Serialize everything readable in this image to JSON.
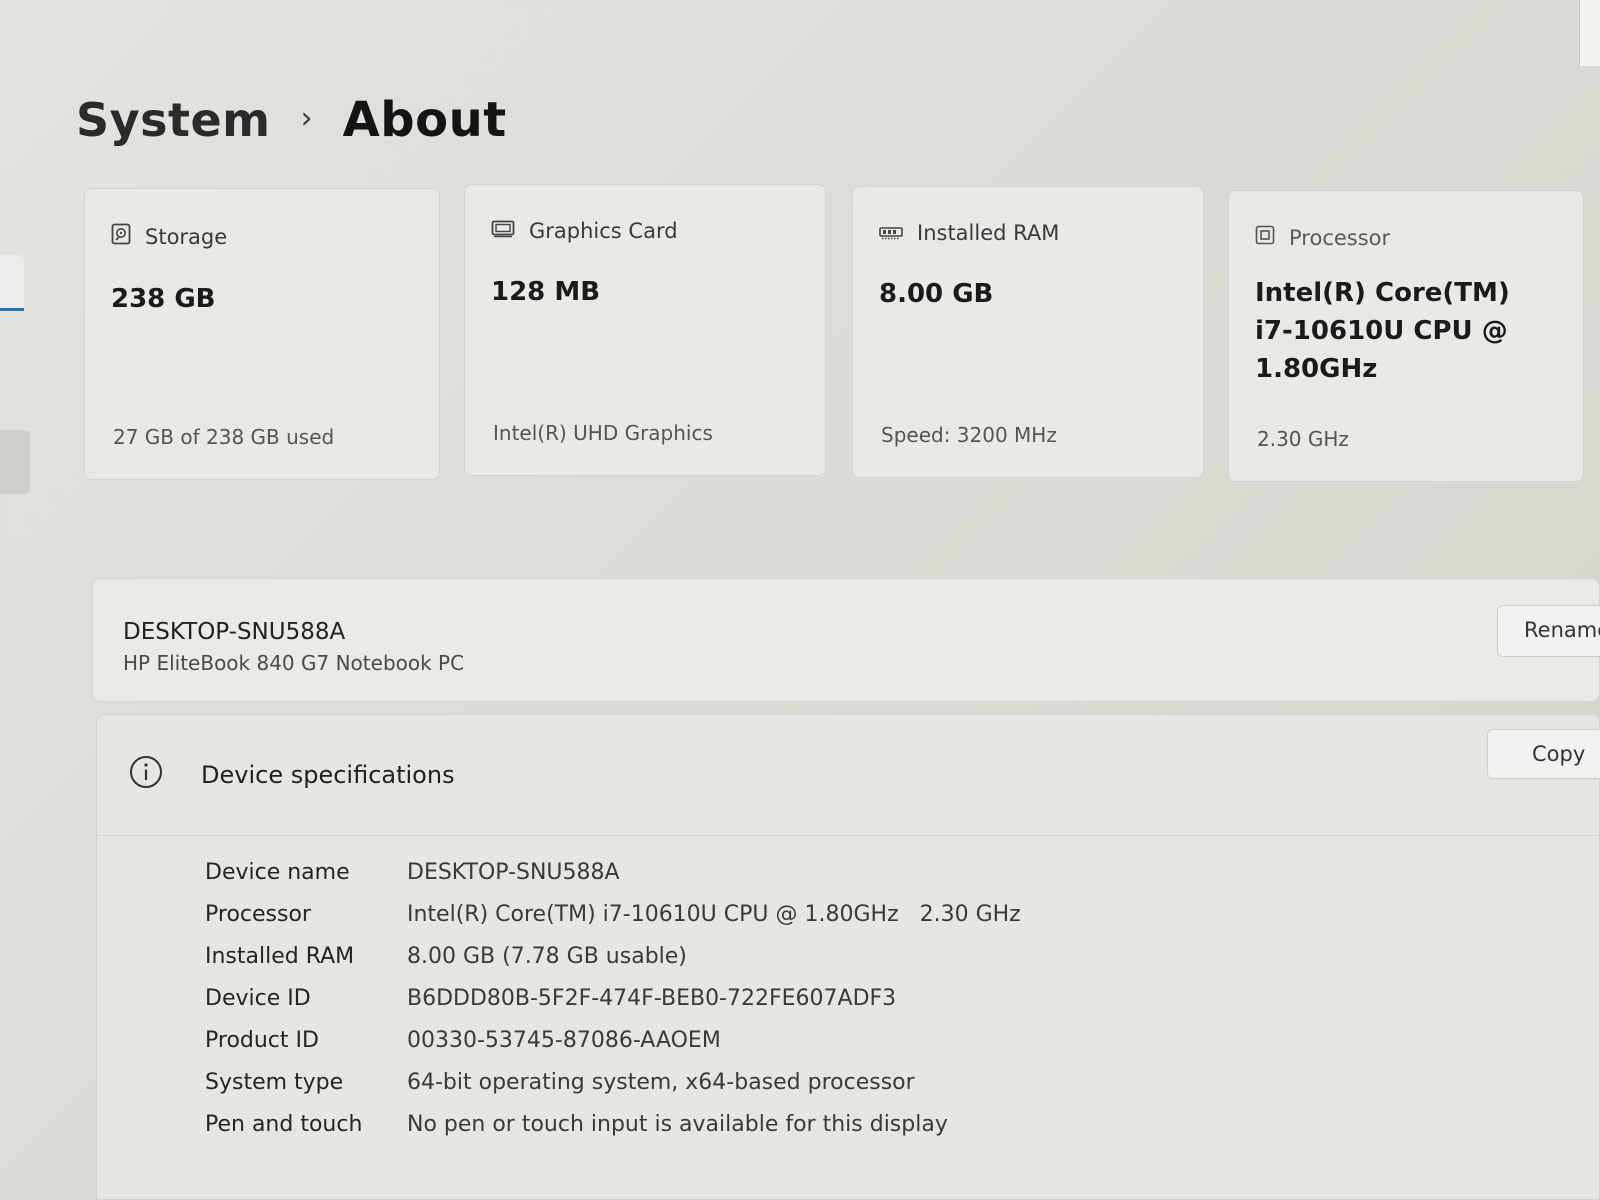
{
  "breadcrumb": {
    "parent": "System",
    "separator": "›",
    "current": "About"
  },
  "cards": {
    "storage": {
      "icon": "storage-icon",
      "title": "Storage",
      "value": "238 GB",
      "sub": "27 GB of 238 GB used"
    },
    "graphics": {
      "icon": "graphics-card-icon",
      "title": "Graphics Card",
      "value": "128 MB",
      "sub": "Intel(R) UHD Graphics"
    },
    "ram": {
      "icon": "ram-icon",
      "title": "Installed RAM",
      "value": "8.00 GB",
      "sub": "Speed: 3200 MHz"
    },
    "processor": {
      "icon": "processor-icon",
      "title": "Processor",
      "value_lines": [
        "Intel(R) Core(TM)",
        "i7-10610U CPU @",
        "1.80GHz"
      ],
      "sub": "2.30 GHz"
    }
  },
  "device": {
    "name": "DESKTOP-SNU588A",
    "model": "HP EliteBook 840 G7 Notebook PC",
    "rename_label": "Rename"
  },
  "specs": {
    "title": "Device specifications",
    "icon": "info-icon",
    "copy_label": "Copy",
    "rows": [
      {
        "label": "Device name",
        "value": "DESKTOP-SNU588A"
      },
      {
        "label": "Processor",
        "value": "Intel(R) Core(TM) i7-10610U CPU @ 1.80GHz   2.30 GHz"
      },
      {
        "label": "Installed RAM",
        "value": "8.00 GB (7.78 GB usable)"
      },
      {
        "label": "Device ID",
        "value": "B6DDD80B-5F2F-474F-BEB0-722FE607ADF3"
      },
      {
        "label": "Product ID",
        "value": "00330-53745-87086-AAOEM"
      },
      {
        "label": "System type",
        "value": "64-bit operating system, x64-based processor"
      },
      {
        "label": "Pen and touch",
        "value": "No pen or touch input is available for this display"
      }
    ]
  },
  "colors": {
    "accent": "#2f6fbf",
    "background": "#dcdcd6",
    "card": "#e9e9e6"
  }
}
